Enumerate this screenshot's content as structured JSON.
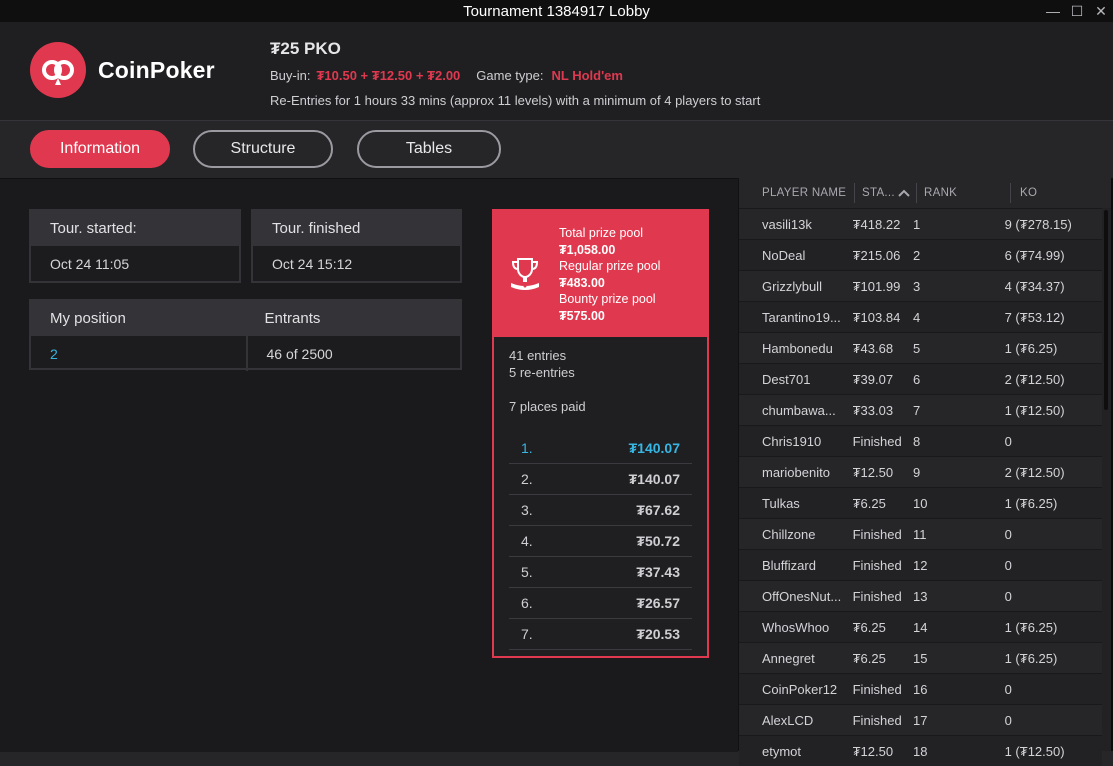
{
  "window": {
    "title": "Tournament 1384917 Lobby",
    "minimize": "—",
    "maximize": "☐",
    "close": "✕"
  },
  "brand": {
    "name": "CoinPoker",
    "color": "#e0394f"
  },
  "tournament": {
    "name": "₮25 PKO",
    "buyin_label": "Buy-in:",
    "buyin_value": "₮10.50 + ₮12.50 + ₮2.00",
    "game_type_label": "Game type:",
    "game_type_value": "NL Hold'em",
    "note": "Re-Entries for 1 hours 33 mins (approx 11 levels) with a minimum of 4 players to start"
  },
  "tabs": [
    {
      "label": "Information",
      "active": true
    },
    {
      "label": "Structure",
      "active": false
    },
    {
      "label": "Tables",
      "active": false
    }
  ],
  "info": {
    "started_label": "Tour. started:",
    "started_value": "Oct 24 11:05",
    "finished_label": "Tour. finished",
    "finished_value": "Oct 24 15:12",
    "position_label": "My position",
    "position_value": "2",
    "entrants_label": "Entrants",
    "entrants_value": "46 of 2500"
  },
  "prize": {
    "total_label": "Total prize pool",
    "total_value": "₮1,058.00",
    "regular_label": "Regular prize pool",
    "regular_value": "₮483.00",
    "bounty_label": "Bounty prize pool",
    "bounty_value": "₮575.00",
    "entries": "41 entries",
    "reentries": "5 re-entries",
    "places_paid": "7 places paid",
    "payouts": [
      {
        "place": "1.",
        "amount": "₮140.07"
      },
      {
        "place": "2.",
        "amount": "₮140.07"
      },
      {
        "place": "3.",
        "amount": "₮67.62"
      },
      {
        "place": "4.",
        "amount": "₮50.72"
      },
      {
        "place": "5.",
        "amount": "₮37.43"
      },
      {
        "place": "6.",
        "amount": "₮26.57"
      },
      {
        "place": "7.",
        "amount": "₮20.53"
      }
    ]
  },
  "players": {
    "headers": {
      "name": "PLAYER NAME",
      "stack": "STA...",
      "rank": "RANK",
      "ko": "KO"
    },
    "sort_icon": "sort-up-icon",
    "rows": [
      {
        "name": "vasili13k",
        "stack": "₮418.22",
        "rank": "1",
        "ko": "9 (₮278.15)"
      },
      {
        "name": "NoDeal",
        "stack": "₮215.06",
        "rank": "2",
        "ko": "6 (₮74.99)"
      },
      {
        "name": "Grizzlybull",
        "stack": "₮101.99",
        "rank": "3",
        "ko": "4 (₮34.37)"
      },
      {
        "name": "Tarantino19...",
        "stack": "₮103.84",
        "rank": "4",
        "ko": "7 (₮53.12)"
      },
      {
        "name": "Hambonedu",
        "stack": "₮43.68",
        "rank": "5",
        "ko": "1 (₮6.25)"
      },
      {
        "name": "Dest701",
        "stack": "₮39.07",
        "rank": "6",
        "ko": "2 (₮12.50)"
      },
      {
        "name": "chumbawa...",
        "stack": "₮33.03",
        "rank": "7",
        "ko": "1 (₮12.50)"
      },
      {
        "name": "Chris1910",
        "stack": "Finished",
        "rank": "8",
        "ko": "0"
      },
      {
        "name": "mariobenito",
        "stack": "₮12.50",
        "rank": "9",
        "ko": "2 (₮12.50)"
      },
      {
        "name": "Tulkas",
        "stack": "₮6.25",
        "rank": "10",
        "ko": "1 (₮6.25)"
      },
      {
        "name": "Chillzone",
        "stack": "Finished",
        "rank": "11",
        "ko": "0"
      },
      {
        "name": "Bluffizard",
        "stack": "Finished",
        "rank": "12",
        "ko": "0"
      },
      {
        "name": "OffOnesNut...",
        "stack": "Finished",
        "rank": "13",
        "ko": "0"
      },
      {
        "name": "WhosWhoo",
        "stack": "₮6.25",
        "rank": "14",
        "ko": "1 (₮6.25)"
      },
      {
        "name": "Annegret",
        "stack": "₮6.25",
        "rank": "15",
        "ko": "1 (₮6.25)"
      },
      {
        "name": "CoinPoker12",
        "stack": "Finished",
        "rank": "16",
        "ko": "0"
      },
      {
        "name": "AlexLCD",
        "stack": "Finished",
        "rank": "17",
        "ko": "0"
      },
      {
        "name": "etymot",
        "stack": "₮12.50",
        "rank": "18",
        "ko": "1 (₮12.50)"
      }
    ]
  }
}
